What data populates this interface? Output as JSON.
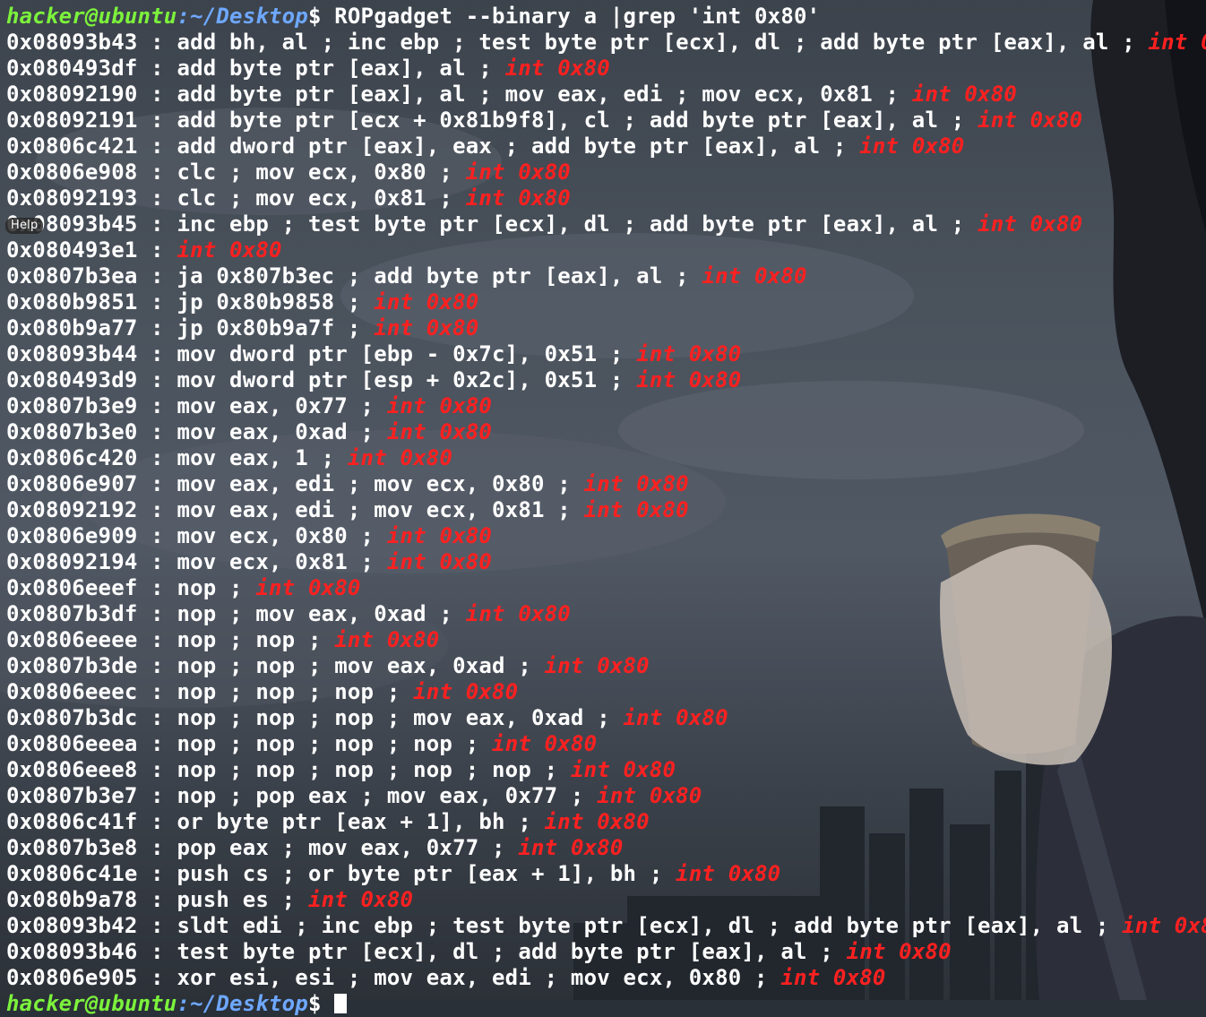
{
  "prompt": {
    "user_host": "hacker@ubuntu",
    "colon": ":",
    "path": "~/Desktop",
    "dollar": "$",
    "command": " ROPgadget --binary a |grep 'int 0x80'"
  },
  "help_label": "Help",
  "highlight_term": "int 0x80",
  "lines": [
    {
      "addr": "0x08093b43",
      "text": "add bh, al ; inc ebp ; test byte ptr [ecx], dl ; add byte ptr [eax], al ; "
    },
    {
      "addr": "0x080493df",
      "text": "add byte ptr [eax], al ; "
    },
    {
      "addr": "0x08092190",
      "text": "add byte ptr [eax], al ; mov eax, edi ; mov ecx, 0x81 ; "
    },
    {
      "addr": "0x08092191",
      "text": "add byte ptr [ecx + 0x81b9f8], cl ; add byte ptr [eax], al ; "
    },
    {
      "addr": "0x0806c421",
      "text": "add dword ptr [eax], eax ; add byte ptr [eax], al ; "
    },
    {
      "addr": "0x0806e908",
      "text": "clc ; mov ecx, 0x80 ; "
    },
    {
      "addr": "0x08092193",
      "text": "clc ; mov ecx, 0x81 ; "
    },
    {
      "addr": "0x08093b45",
      "text": "inc ebp ; test byte ptr [ecx], dl ; add byte ptr [eax], al ; "
    },
    {
      "addr": "0x080493e1",
      "text": ""
    },
    {
      "addr": "0x0807b3ea",
      "text": "ja 0x807b3ec ; add byte ptr [eax], al ; "
    },
    {
      "addr": "0x080b9851",
      "text": "jp 0x80b9858 ; "
    },
    {
      "addr": "0x080b9a77",
      "text": "jp 0x80b9a7f ; "
    },
    {
      "addr": "0x08093b44",
      "text": "mov dword ptr [ebp - 0x7c], 0x51 ; "
    },
    {
      "addr": "0x080493d9",
      "text": "mov dword ptr [esp + 0x2c], 0x51 ; "
    },
    {
      "addr": "0x0807b3e9",
      "text": "mov eax, 0x77 ; "
    },
    {
      "addr": "0x0807b3e0",
      "text": "mov eax, 0xad ; "
    },
    {
      "addr": "0x0806c420",
      "text": "mov eax, 1 ; "
    },
    {
      "addr": "0x0806e907",
      "text": "mov eax, edi ; mov ecx, 0x80 ; "
    },
    {
      "addr": "0x08092192",
      "text": "mov eax, edi ; mov ecx, 0x81 ; "
    },
    {
      "addr": "0x0806e909",
      "text": "mov ecx, 0x80 ; "
    },
    {
      "addr": "0x08092194",
      "text": "mov ecx, 0x81 ; "
    },
    {
      "addr": "0x0806eeef",
      "text": "nop ; "
    },
    {
      "addr": "0x0807b3df",
      "text": "nop ; mov eax, 0xad ; "
    },
    {
      "addr": "0x0806eeee",
      "text": "nop ; nop ; "
    },
    {
      "addr": "0x0807b3de",
      "text": "nop ; nop ; mov eax, 0xad ; "
    },
    {
      "addr": "0x0806eeec",
      "text": "nop ; nop ; nop ; "
    },
    {
      "addr": "0x0807b3dc",
      "text": "nop ; nop ; nop ; mov eax, 0xad ; "
    },
    {
      "addr": "0x0806eeea",
      "text": "nop ; nop ; nop ; nop ; "
    },
    {
      "addr": "0x0806eee8",
      "text": "nop ; nop ; nop ; nop ; nop ; "
    },
    {
      "addr": "0x0807b3e7",
      "text": "nop ; pop eax ; mov eax, 0x77 ; "
    },
    {
      "addr": "0x0806c41f",
      "text": "or byte ptr [eax + 1], bh ; "
    },
    {
      "addr": "0x0807b3e8",
      "text": "pop eax ; mov eax, 0x77 ; "
    },
    {
      "addr": "0x0806c41e",
      "text": "push cs ; or byte ptr [eax + 1], bh ; "
    },
    {
      "addr": "0x080b9a78",
      "text": "push es ; "
    },
    {
      "addr": "0x08093b42",
      "text": "sldt edi ; inc ebp ; test byte ptr [ecx], dl ; add byte ptr [eax], al ; "
    },
    {
      "addr": "0x08093b46",
      "text": "test byte ptr [ecx], dl ; add byte ptr [eax], al ; "
    },
    {
      "addr": "0x0806e905",
      "text": "xor esi, esi ; mov eax, edi ; mov ecx, 0x80 ; "
    }
  ],
  "separator": " : "
}
